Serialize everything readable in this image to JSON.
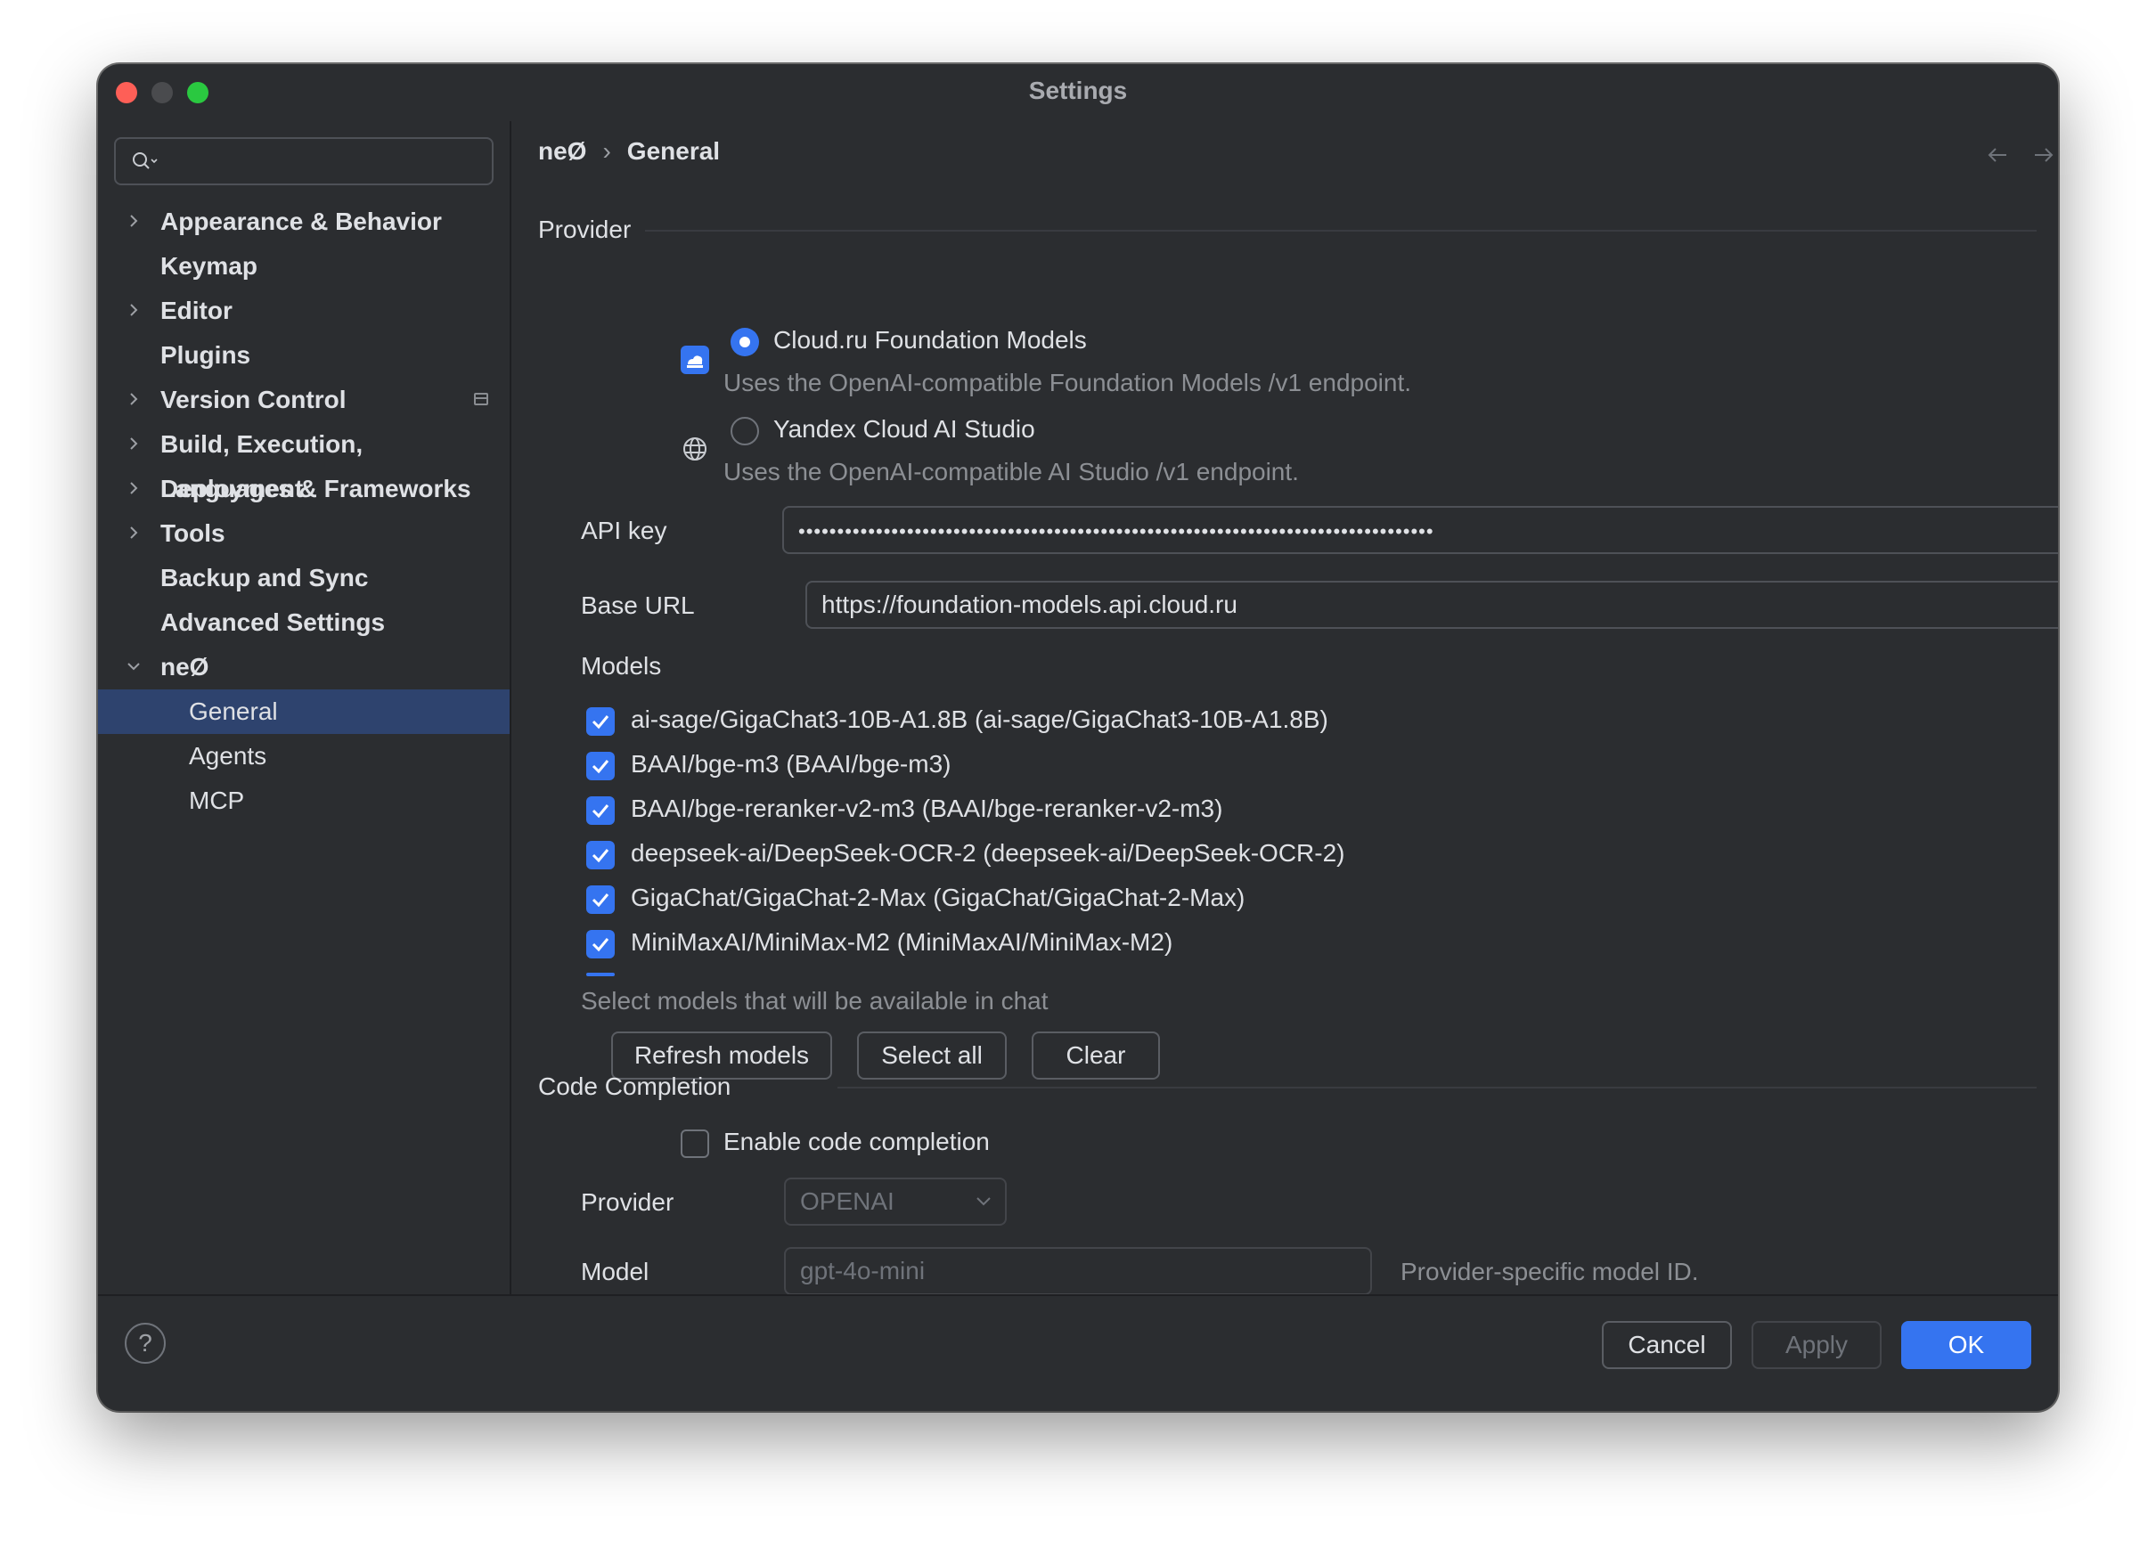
{
  "window": {
    "title": "Settings"
  },
  "sidebar": {
    "search_placeholder": "",
    "items": [
      {
        "label": "Appearance & Behavior"
      },
      {
        "label": "Keymap"
      },
      {
        "label": "Editor"
      },
      {
        "label": "Plugins"
      },
      {
        "label": "Version Control"
      },
      {
        "label": "Build, Execution, Deployment"
      },
      {
        "label": "Languages & Frameworks"
      },
      {
        "label": "Tools"
      },
      {
        "label": "Backup and Sync"
      },
      {
        "label": "Advanced Settings"
      },
      {
        "label": "neØ"
      },
      {
        "label": "General"
      },
      {
        "label": "Agents"
      },
      {
        "label": "MCP"
      }
    ],
    "selected": "General"
  },
  "breadcrumb": {
    "parent": "neØ",
    "separator": "›",
    "current": "General"
  },
  "provider": {
    "section_title": "Provider",
    "options": [
      {
        "label": "Cloud.ru Foundation Models",
        "description": "Uses the OpenAI-compatible Foundation Models /v1 endpoint.",
        "selected": true,
        "icon": "cloud-icon"
      },
      {
        "label": "Yandex Cloud AI Studio",
        "description": "Uses the OpenAI-compatible AI Studio /v1 endpoint.",
        "selected": false,
        "icon": "globe-icon"
      }
    ],
    "api_key_label": "API key",
    "api_key_value": "••••••••••••••••••••••••••••••••••••••••••••••••••••••••••••••••••••••••••••••••••",
    "base_url_label": "Base URL",
    "base_url_value": "https://foundation-models.api.cloud.ru"
  },
  "models": {
    "label": "Models",
    "items": [
      {
        "label": "ai-sage/GigaChat3-10B-A1.8B (ai-sage/GigaChat3-10B-A1.8B)",
        "checked": true
      },
      {
        "label": "BAAI/bge-m3 (BAAI/bge-m3)",
        "checked": true
      },
      {
        "label": "BAAI/bge-reranker-v2-m3 (BAAI/bge-reranker-v2-m3)",
        "checked": true
      },
      {
        "label": "deepseek-ai/DeepSeek-OCR-2 (deepseek-ai/DeepSeek-OCR-2)",
        "checked": true
      },
      {
        "label": "GigaChat/GigaChat-2-Max (GigaChat/GigaChat-2-Max)",
        "checked": true
      },
      {
        "label": "MiniMaxAI/MiniMax-M2 (MiniMaxAI/MiniMax-M2)",
        "checked": true
      }
    ],
    "hint": "Select models that will be available in chat",
    "refresh_label": "Refresh models",
    "select_all_label": "Select all",
    "clear_label": "Clear"
  },
  "code_completion": {
    "section_title": "Code Completion",
    "enable_label": "Enable code completion",
    "enabled": false,
    "provider_label": "Provider",
    "provider_value": "OPENAI",
    "model_label": "Model",
    "model_placeholder": "gpt-4o-mini",
    "model_hint": "Provider-specific model ID."
  },
  "footer": {
    "help": "?",
    "cancel_label": "Cancel",
    "apply_label": "Apply",
    "ok_label": "OK"
  },
  "colors": {
    "accent": "#3574f0",
    "background": "#2b2d30",
    "selection": "#2e436e"
  }
}
